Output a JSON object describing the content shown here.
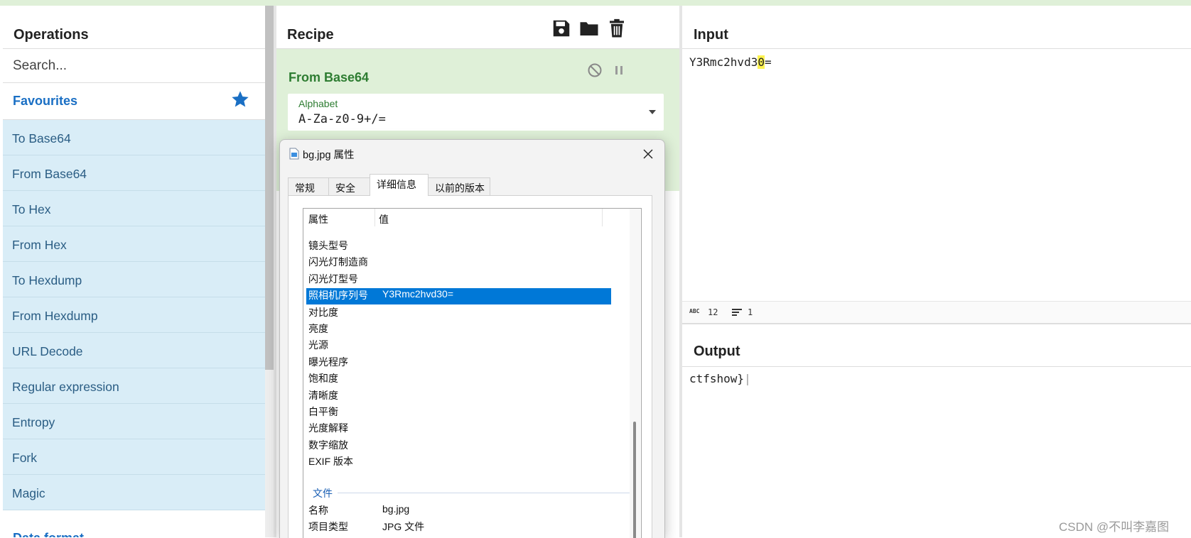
{
  "operations": {
    "title": "Operations",
    "search_placeholder": "Search...",
    "favourites_label": "Favourites",
    "items": [
      "To Base64",
      "From Base64",
      "To Hex",
      "From Hex",
      "To Hexdump",
      "From Hexdump",
      "URL Decode",
      "Regular expression",
      "Entropy",
      "Fork",
      "Magic"
    ],
    "next_category": "Data format"
  },
  "recipe": {
    "title": "Recipe",
    "operation": {
      "name": "From Base64",
      "alphabet_label": "Alphabet",
      "alphabet_value": "A-Za-z0-9+/="
    }
  },
  "input": {
    "title": "Input",
    "text_before": "Y3Rmc2hvd3",
    "text_highlight": "0",
    "text_after": "=",
    "status_length": "12",
    "status_lines": "1"
  },
  "output": {
    "title": "Output",
    "text": "ctfshow}",
    "text_cursor": "|"
  },
  "dialog": {
    "title": "bg.jpg 属性",
    "tabs": [
      "常规",
      "安全",
      "详细信息",
      "以前的版本"
    ],
    "active_tab": "详细信息",
    "columns": [
      "属性",
      "值"
    ],
    "rows": [
      {
        "name": "镜头型号",
        "value": ""
      },
      {
        "name": "闪光灯制造商",
        "value": ""
      },
      {
        "name": "闪光灯型号",
        "value": ""
      },
      {
        "name": "照相机序列号",
        "value": "Y3Rmc2hvd30="
      },
      {
        "name": "对比度",
        "value": ""
      },
      {
        "name": "亮度",
        "value": ""
      },
      {
        "name": "光源",
        "value": ""
      },
      {
        "name": "曝光程序",
        "value": ""
      },
      {
        "name": "饱和度",
        "value": ""
      },
      {
        "name": "清晰度",
        "value": ""
      },
      {
        "name": "白平衡",
        "value": ""
      },
      {
        "name": "光度解释",
        "value": ""
      },
      {
        "name": "数字缩放",
        "value": ""
      },
      {
        "name": "EXIF 版本",
        "value": ""
      }
    ],
    "selected_row": "照相机序列号",
    "group_file": "文件",
    "file_rows": [
      {
        "name": "名称",
        "value": "bg.jpg"
      },
      {
        "name": "项目类型",
        "value": "JPG 文件"
      }
    ]
  },
  "watermark": "CSDN @不叫李嘉图",
  "colors": {
    "ops_item_bg": "#d9edf7",
    "recipe_card_bg": "#dff0d8",
    "selection_blue": "#0078d7",
    "highlight_yellow": "#fdf34f"
  }
}
